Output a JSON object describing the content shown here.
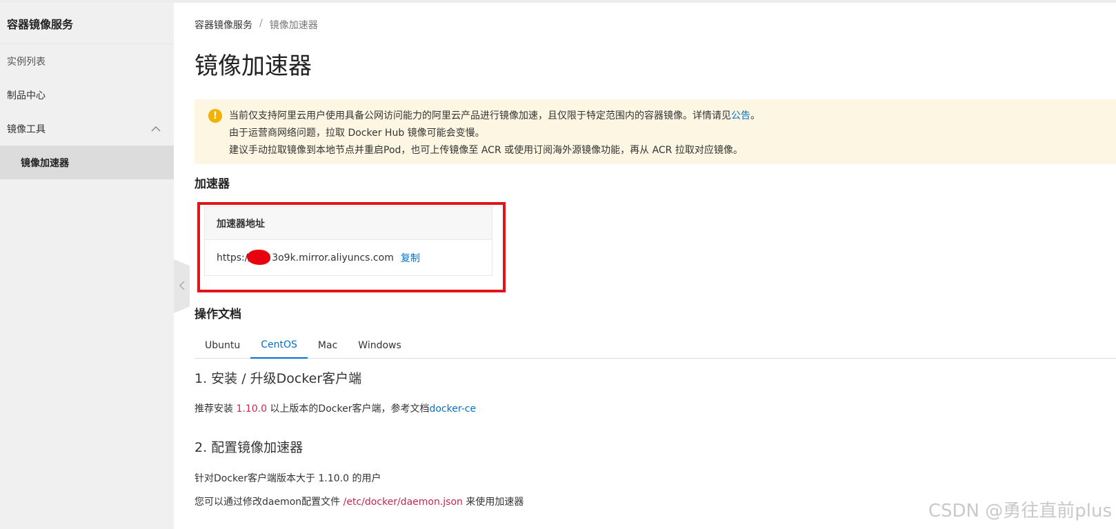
{
  "sidebar": {
    "title": "容器镜像服务",
    "items": [
      {
        "label": "实例列表"
      },
      {
        "label": "制品中心"
      },
      {
        "label": "镜像工具",
        "expanded": true
      }
    ],
    "subitems": [
      {
        "label": "镜像加速器",
        "active": true
      }
    ]
  },
  "breadcrumb": {
    "root": "容器镜像服务",
    "separator": "/",
    "current": "镜像加速器"
  },
  "page_title": "镜像加速器",
  "notice": {
    "line1_text": "当前仅支持阿里云用户使用具备公网访问能力的阿里云产品进行镜像加速，且仅限于特定范围内的容器镜像。详情请见",
    "line1_link": "公告",
    "line1_end": "。",
    "line2": "由于运营商网络问题，拉取 Docker Hub 镜像可能会变慢。",
    "line3": "建议手动拉取镜像到本地节点并重启Pod，也可上传镜像至 ACR 或使用订阅海外源镜像功能，再从 ACR 拉取对应镜像。"
  },
  "accelerator": {
    "section_title": "加速器",
    "column_header": "加速器地址",
    "url_prefix": "https://",
    "url_suffix": "3o9k.mirror.aliyuncs.com",
    "copy_label": "复制"
  },
  "docs": {
    "section_title": "操作文档",
    "tabs": [
      {
        "label": "Ubuntu"
      },
      {
        "label": "CentOS",
        "active": true
      },
      {
        "label": "Mac"
      },
      {
        "label": "Windows"
      }
    ],
    "step1": {
      "title": "1. 安装 / 升级Docker客户端",
      "text_before": "推荐安装 ",
      "version": "1.10.0",
      "text_after": " 以上版本的Docker客户端，参考文档",
      "link": "docker-ce"
    },
    "step2": {
      "title": "2. 配置镜像加速器",
      "line1": "针对Docker客户端版本大于 1.10.0 的用户",
      "line2_before": "您可以通过修改daemon配置文件 ",
      "path": "/etc/docker/daemon.json",
      "line2_after": " 来使用加速器"
    }
  },
  "watermark": "CSDN @勇往直前plus",
  "colors": {
    "accent": "#0070cc",
    "highlight_box": "#e1131b",
    "notice_bg": "#fdf6e3",
    "warn_icon": "#f5b100",
    "code_red": "#c7254e"
  }
}
